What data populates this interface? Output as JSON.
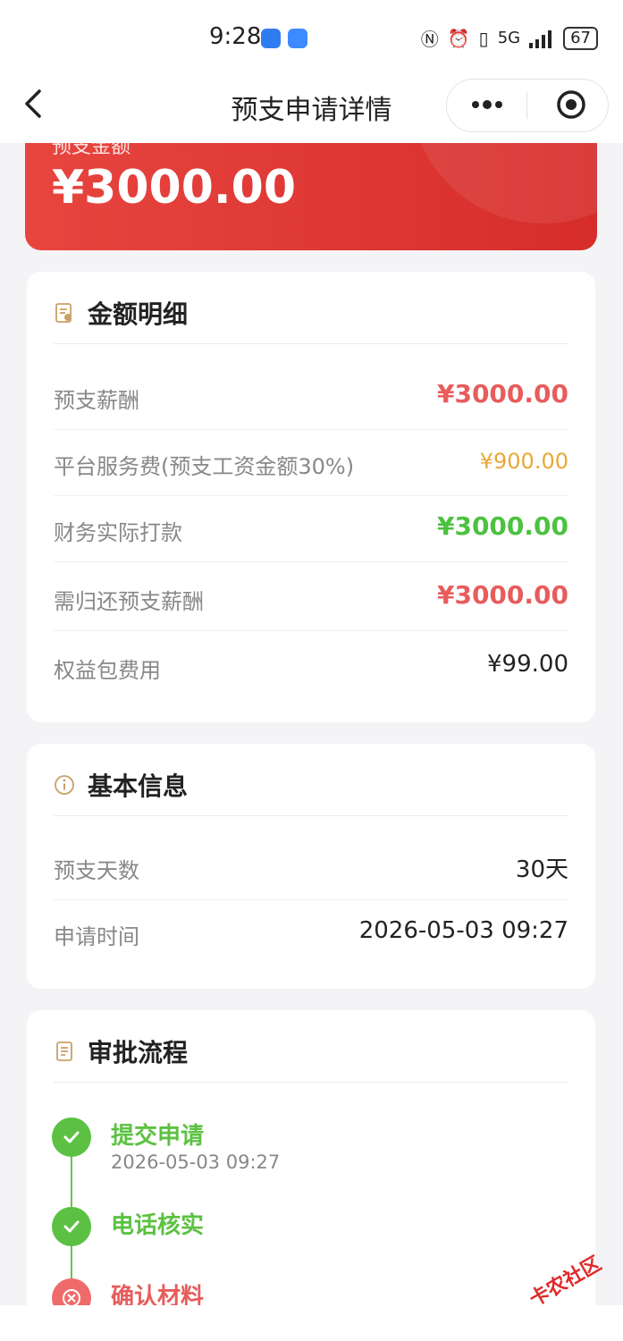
{
  "status_bar": {
    "time": "9:28",
    "network": "5G",
    "battery": "67"
  },
  "nav": {
    "title": "预支申请详情",
    "back_icon": "chevron-left-icon",
    "more_icon": "more-dots-icon",
    "close_icon": "target-close-icon"
  },
  "hero": {
    "label": "预支金额",
    "amount": "¥3000.00",
    "color": "#e03a36"
  },
  "amount_card": {
    "title": "金额明细",
    "rows": [
      {
        "label": "预支薪酬",
        "value": "¥3000.00",
        "color": "#e85c5c"
      },
      {
        "label": "平台服务费(预支工资金额30%)",
        "value": "¥900.00",
        "color": "#e8a83a"
      },
      {
        "label": "财务实际打款",
        "value": "¥3000.00",
        "color": "#4cc240"
      },
      {
        "label": "需归还预支薪酬",
        "value": "¥3000.00",
        "color": "#e85c5c"
      },
      {
        "label": "权益包费用",
        "value": "¥99.00",
        "color": "#222222"
      }
    ]
  },
  "basic_card": {
    "title": "基本信息",
    "rows": [
      {
        "label": "预支天数",
        "value": "30天"
      },
      {
        "label": "申请时间",
        "value": "2026-05-03 09:27"
      }
    ]
  },
  "approval_card": {
    "title": "审批流程",
    "steps": [
      {
        "title": "提交申请",
        "time": "2026-05-03 09:27",
        "status": "done"
      },
      {
        "title": "电话核实",
        "time": "",
        "status": "done"
      },
      {
        "title": "确认材料",
        "time": "",
        "status": "rejected"
      }
    ]
  },
  "watermark": {
    "text": "卡农社区"
  }
}
